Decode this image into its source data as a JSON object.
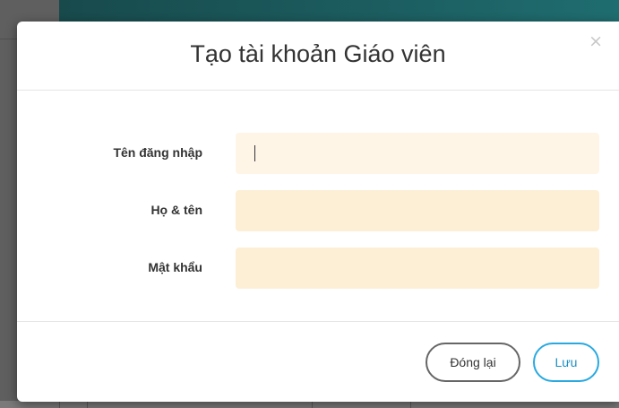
{
  "modal": {
    "title": "Tạo tài khoản Giáo viên",
    "close_symbol": "×"
  },
  "form": {
    "fields": [
      {
        "label": "Tên đăng nhập",
        "value": "",
        "placeholder": ""
      },
      {
        "label": "Họ & tên",
        "value": "",
        "placeholder": ""
      },
      {
        "label": "Mật khẩu",
        "value": "",
        "placeholder": ""
      }
    ]
  },
  "footer": {
    "close_label": "Đóng lại",
    "save_label": "Lưu"
  },
  "colors": {
    "input_background": "#fdefd6",
    "save_accent": "#29a9e0",
    "header_bar": "#1c5e61"
  },
  "icons": {
    "close": "close-icon"
  }
}
